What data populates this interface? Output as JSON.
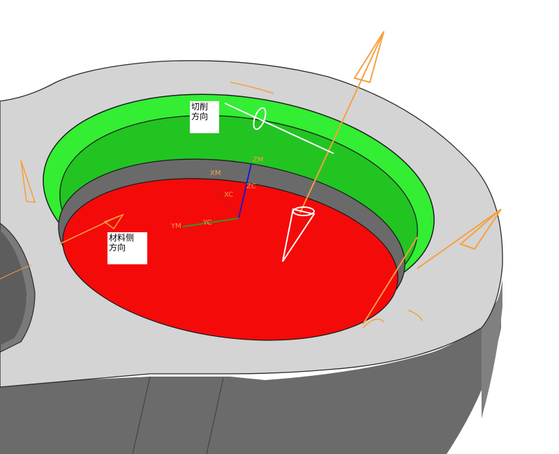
{
  "callouts": {
    "cut_direction": {
      "line1": "切削",
      "line2": "方向"
    },
    "material_side": {
      "line1": "材料侧",
      "line2": "方向"
    }
  },
  "axes": {
    "zm": "ZM",
    "zc": "ZC",
    "xm": "XM",
    "xc": "XC",
    "ym": "YM",
    "yc": "YC"
  },
  "colors": {
    "part_top": "#d4d4d4",
    "part_side": "#6b6b6b",
    "floor_face": "#f50a0a",
    "wall_face_light": "#33ee33",
    "wall_face_dark": "#22c422",
    "vector_orange": "#f5a040",
    "z_axis": "#1a1acc",
    "y_axis": "#2a9a2a"
  },
  "icons": {
    "cut_vector": "arrow-icon",
    "material_vector": "arrow-icon",
    "tool_axis": "cone-arrow-icon"
  }
}
